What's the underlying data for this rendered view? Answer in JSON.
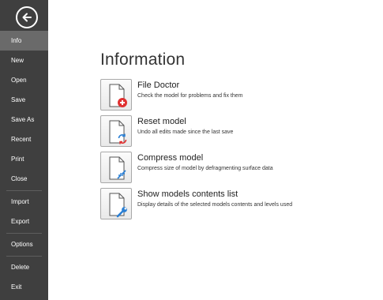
{
  "sidebar": {
    "items": [
      {
        "label": "Info",
        "active": true
      },
      {
        "label": "New"
      },
      {
        "label": "Open"
      },
      {
        "label": "Save"
      },
      {
        "label": "Save As"
      },
      {
        "label": "Recent"
      },
      {
        "label": "Print"
      },
      {
        "label": "Close"
      },
      {
        "label": "Import"
      },
      {
        "label": "Export"
      },
      {
        "label": "Options"
      },
      {
        "label": "Delete"
      },
      {
        "label": "Exit"
      }
    ]
  },
  "main": {
    "title": "Information",
    "actions": [
      {
        "title": "File Doctor",
        "description": "Check the model for problems and fix them",
        "icon": "document-plus-icon"
      },
      {
        "title": "Reset model",
        "description": "Undo all edits made since the last save",
        "icon": "document-refresh-icon"
      },
      {
        "title": "Compress model",
        "description": "Compress size of model by defragmenting surface data",
        "icon": "document-compress-icon"
      },
      {
        "title": "Show models contents list",
        "description": "Display details of the selected models contents and levels used",
        "icon": "document-wrench-icon"
      }
    ]
  },
  "colors": {
    "sidebar_bg": "#3f3f3f",
    "sidebar_active": "#6a6a6a",
    "accent_red": "#e03030",
    "accent_blue": "#2a7fd4"
  }
}
